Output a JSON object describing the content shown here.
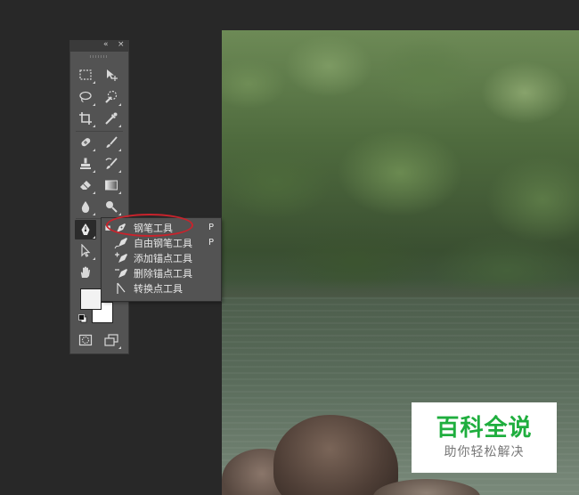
{
  "panel": {
    "collapse_glyph": "«",
    "close_glyph": "×"
  },
  "tools": [
    {
      "name": "rectangular-marquee-icon"
    },
    {
      "name": "move-tool-icon"
    },
    {
      "name": "lasso-icon"
    },
    {
      "name": "quick-selection-icon"
    },
    {
      "name": "crop-icon"
    },
    {
      "name": "eyedropper-icon"
    },
    {
      "name": "spot-healing-icon"
    },
    {
      "name": "brush-icon"
    },
    {
      "name": "clone-stamp-icon"
    },
    {
      "name": "history-brush-icon"
    },
    {
      "name": "eraser-icon"
    },
    {
      "name": "gradient-icon"
    },
    {
      "name": "blur-icon"
    },
    {
      "name": "dodge-icon"
    },
    {
      "name": "pen-icon"
    },
    {
      "name": "type-icon"
    },
    {
      "name": "path-selection-icon"
    },
    {
      "name": "rectangle-shape-icon"
    },
    {
      "name": "hand-icon"
    },
    {
      "name": "zoom-icon"
    }
  ],
  "colors": {
    "foreground": "#f2f2f2",
    "background": "#ffffff",
    "annotation": "#c8232c",
    "watermark_green": "#1fae3e"
  },
  "flyout": {
    "items": [
      {
        "label": "钢笔工具",
        "shortcut": "P",
        "selected": true,
        "icon": "pen-icon"
      },
      {
        "label": "自由钢笔工具",
        "shortcut": "P",
        "selected": false,
        "icon": "freeform-pen-icon"
      },
      {
        "label": "添加锚点工具",
        "shortcut": "",
        "selected": false,
        "icon": "add-anchor-point-icon"
      },
      {
        "label": "删除锚点工具",
        "shortcut": "",
        "selected": false,
        "icon": "delete-anchor-point-icon"
      },
      {
        "label": "转换点工具",
        "shortcut": "",
        "selected": false,
        "icon": "convert-point-icon"
      }
    ]
  },
  "watermark": {
    "title": "百科全说",
    "subtitle": "助你轻松解决"
  }
}
